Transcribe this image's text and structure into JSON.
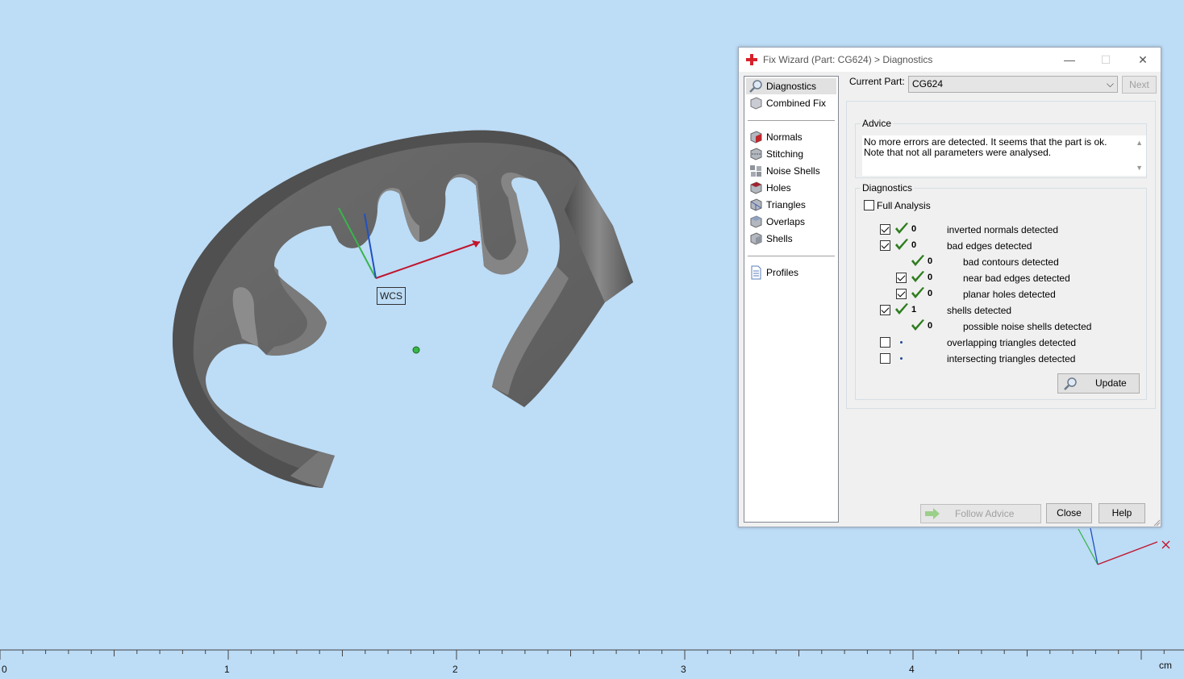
{
  "ruler": {
    "labels": [
      "0",
      "1",
      "2",
      "3",
      "4"
    ],
    "unit": "cm"
  },
  "viewport": {
    "wcs_label": "WCS"
  },
  "dialog": {
    "title": "Fix Wizard (Part: CG624) > Diagnostics",
    "controls": {
      "minimize": "—",
      "maximize": "☐",
      "close": "✕"
    },
    "nav": {
      "top": [
        "Diagnostics",
        "Combined Fix"
      ],
      "fixes": [
        "Normals",
        "Stitching",
        "Noise Shells",
        "Holes",
        "Triangles",
        "Overlaps",
        "Shells"
      ],
      "bottom": [
        "Profiles"
      ],
      "selected": "Diagnostics"
    },
    "current_part_label": "Current Part:",
    "current_part_value": "CG624",
    "next_label": "Next",
    "advice": {
      "label": "Advice",
      "text": "No more errors are detected. It seems that the part is ok. Note that not all parameters were analysed."
    },
    "diagnostics": {
      "label": "Diagnostics",
      "full_analysis_label": "Full Analysis",
      "full_analysis_checked": false,
      "rows": [
        {
          "checkbox": true,
          "checked": true,
          "status": "ok",
          "count": "0",
          "label": "inverted normals detected",
          "indent": 0
        },
        {
          "checkbox": true,
          "checked": true,
          "status": "ok",
          "count": "0",
          "label": "bad edges detected",
          "indent": 0
        },
        {
          "checkbox": false,
          "checked": false,
          "status": "ok",
          "count": "0",
          "label": "bad contours detected",
          "indent": 1
        },
        {
          "checkbox": true,
          "checked": true,
          "status": "ok",
          "count": "0",
          "label": "near bad edges detected",
          "indent": 1
        },
        {
          "checkbox": true,
          "checked": true,
          "status": "ok",
          "count": "0",
          "label": "planar holes detected",
          "indent": 1
        },
        {
          "checkbox": true,
          "checked": true,
          "status": "ok",
          "count": "1",
          "label": "shells detected",
          "indent": 0
        },
        {
          "checkbox": false,
          "checked": false,
          "status": "ok",
          "count": "0",
          "label": "possible noise shells detected",
          "indent": 1
        },
        {
          "checkbox": true,
          "checked": false,
          "status": "none",
          "count": "",
          "label": "overlapping triangles detected",
          "indent": 0
        },
        {
          "checkbox": true,
          "checked": false,
          "status": "none",
          "count": "",
          "label": "intersecting triangles detected",
          "indent": 0
        }
      ],
      "update_label": "Update"
    },
    "follow_advice_label": "Follow Advice",
    "close_label": "Close",
    "help_label": "Help"
  },
  "colors": {
    "background": "#bddcf6",
    "ok_check": "#2e7d1f",
    "axis_x": "#c0152c",
    "axis_y": "#39b54a",
    "axis_z": "#2050c0"
  }
}
